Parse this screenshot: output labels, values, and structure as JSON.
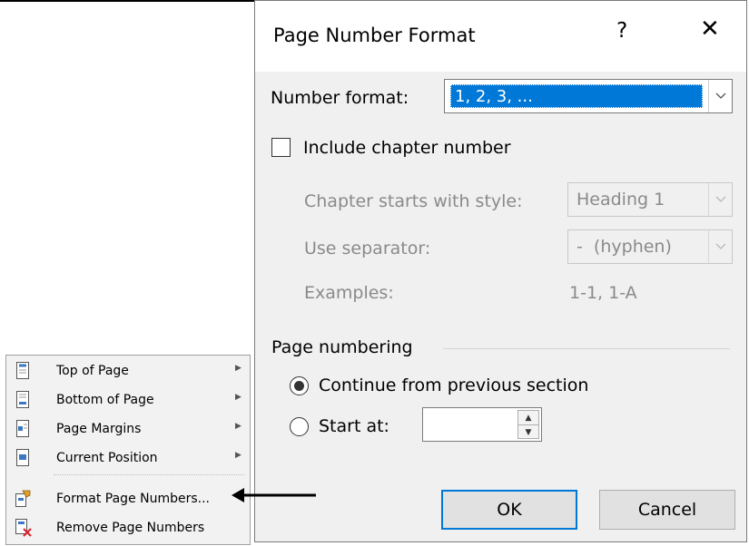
{
  "dialog": {
    "title": "Page Number Format",
    "help_glyph": "?",
    "close_glyph": "✕",
    "number_format_label": "Number format:",
    "number_format_value": "1, 2, 3, ...",
    "include_chapter_label": "Include chapter number",
    "include_chapter_checked": false,
    "chapter_style_label": "Chapter starts with style:",
    "chapter_style_value": "Heading 1",
    "separator_label": "Use separator:",
    "separator_value": "-  (hyphen)",
    "examples_label": "Examples:",
    "examples_value": "1-1, 1-A",
    "page_numbering_label": "Page numbering",
    "continue_label": "Continue from previous section",
    "continue_selected": true,
    "start_at_label": "Start at:",
    "start_at_value": "",
    "ok_label": "OK",
    "cancel_label": "Cancel"
  },
  "menu": {
    "items": [
      {
        "label": "Top of Page",
        "icon": "page-top-icon",
        "submenu": true
      },
      {
        "label": "Bottom of Page",
        "icon": "page-bottom-icon",
        "submenu": true
      },
      {
        "label": "Page Margins",
        "icon": "page-margins-icon",
        "submenu": true
      },
      {
        "label": "Current Position",
        "icon": "current-position-icon",
        "submenu": true
      },
      {
        "label": "Format Page Numbers...",
        "icon": "format-page-numbers-icon",
        "submenu": false
      },
      {
        "label": "Remove Page Numbers",
        "icon": "remove-page-numbers-icon",
        "submenu": false
      }
    ]
  },
  "colors": {
    "selection": "#0078d7",
    "dialog_bg": "#f0f0f0",
    "menu_bg": "#f2f2f2",
    "remove_red": "#d9262f"
  }
}
